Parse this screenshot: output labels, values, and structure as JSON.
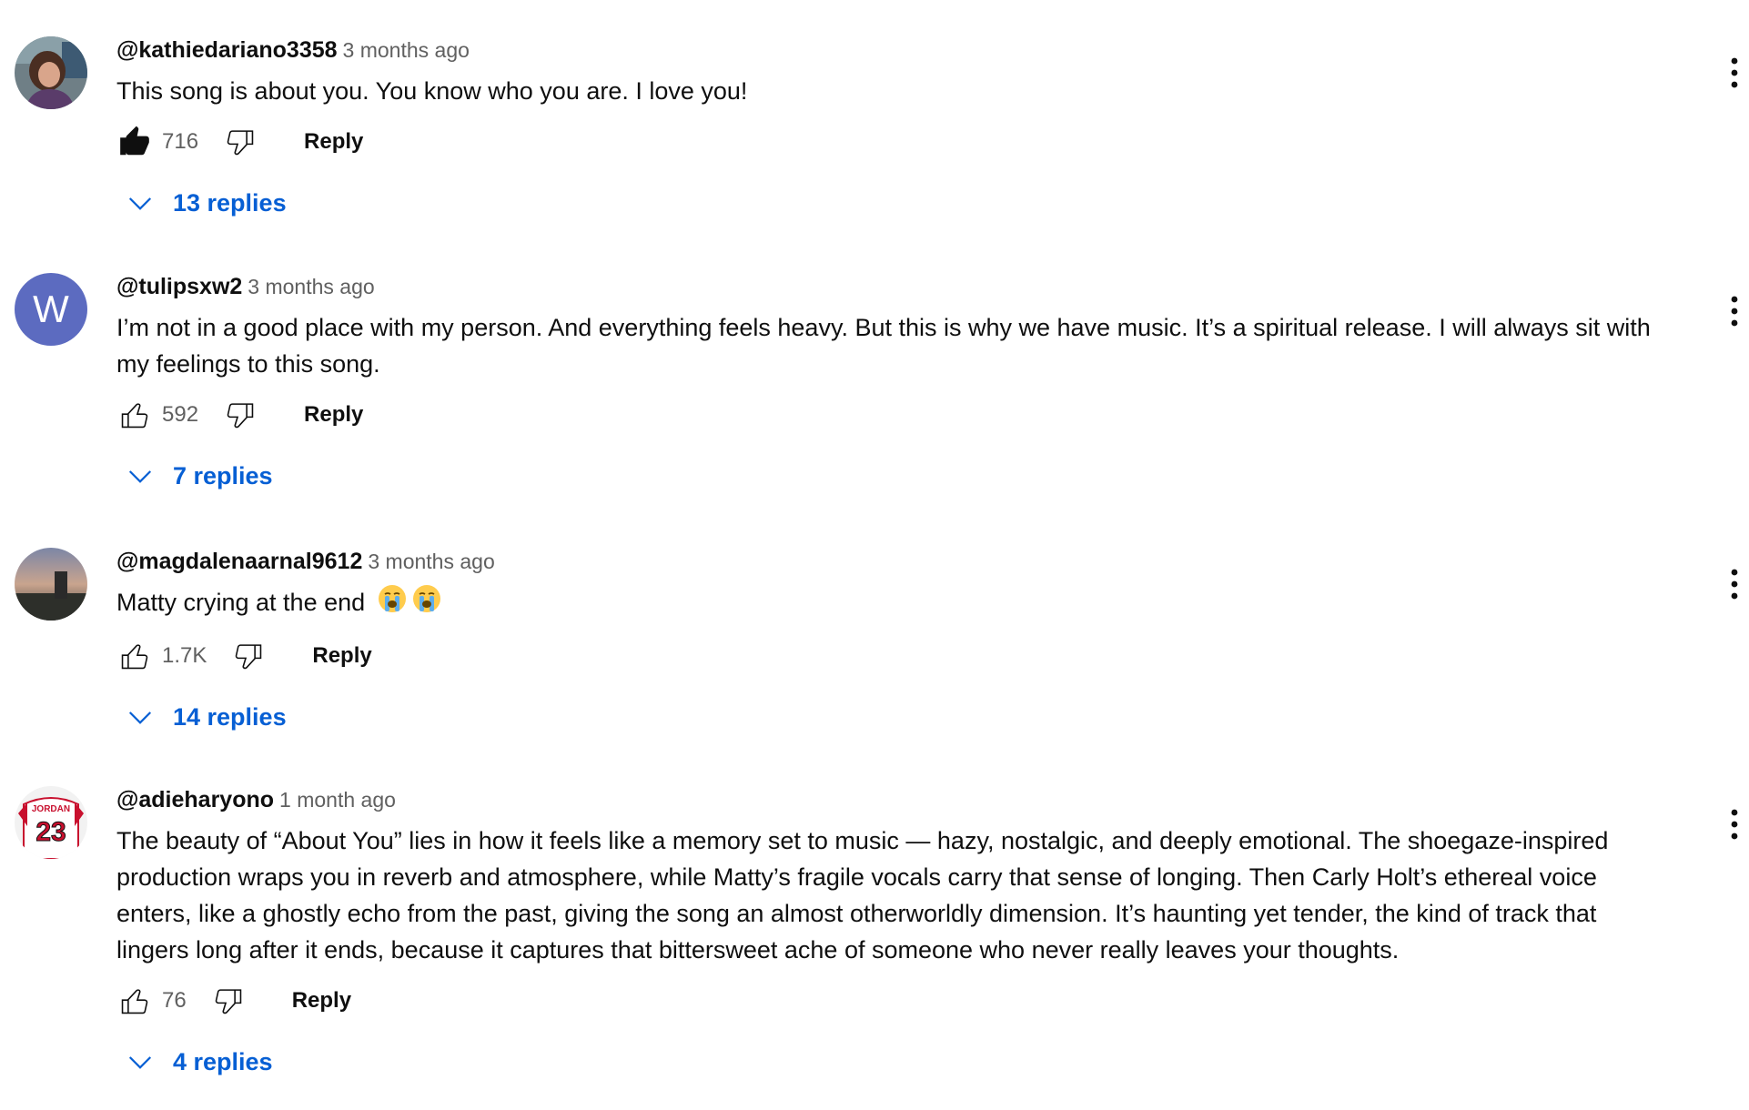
{
  "comments": [
    {
      "author": "@kathiedariano3358",
      "time": "3 months ago",
      "text": "This song is about you. You know who you are. I love you!",
      "likes": "716",
      "liked": true,
      "reply_label": "Reply",
      "replies_label": "13 replies",
      "avatar": "photo-avatar-woman"
    },
    {
      "author": "@tulipsxw2",
      "time": "3 months ago",
      "text": "I’m not in a good place with my person. And everything feels heavy. But this is why we have music. It’s a spiritual release. I will always sit with my feelings to this song.",
      "likes": "592",
      "liked": false,
      "reply_label": "Reply",
      "replies_label": "7 replies",
      "avatar_letter": "W",
      "avatar_color": "#5c6bc0"
    },
    {
      "author": "@magdalenaarnal9612",
      "time": "3 months ago",
      "text": "Matty crying at the end",
      "emojis": [
        "loudly-crying-face-emoji",
        "loudly-crying-face-emoji"
      ],
      "likes": "1.7K",
      "liked": false,
      "reply_label": "Reply",
      "replies_label": "14 replies",
      "avatar": "photo-avatar-sunset"
    },
    {
      "author": "@adieharyono",
      "time": "1 month ago",
      "text": "The beauty of “About You” lies in how it feels like a memory set to music — hazy, nostalgic, and deeply emotional. The shoegaze-inspired production wraps you in reverb and atmosphere, while Matty’s fragile vocals carry that sense of longing. Then Carly Holt’s ethereal voice enters, like a ghostly echo from the past, giving the song an almost otherworldly dimension. It’s haunting yet tender, the kind of track that lingers long after it ends, because it captures that bittersweet ache of someone who never really leaves your thoughts.",
      "likes": "76",
      "liked": false,
      "reply_label": "Reply",
      "replies_label": "4 replies",
      "avatar": "photo-avatar-jersey",
      "avatar_text": "JORDAN 23"
    }
  ],
  "colors": {
    "link": "#065fd4",
    "text": "#0f0f0f",
    "secondary": "#606060"
  }
}
